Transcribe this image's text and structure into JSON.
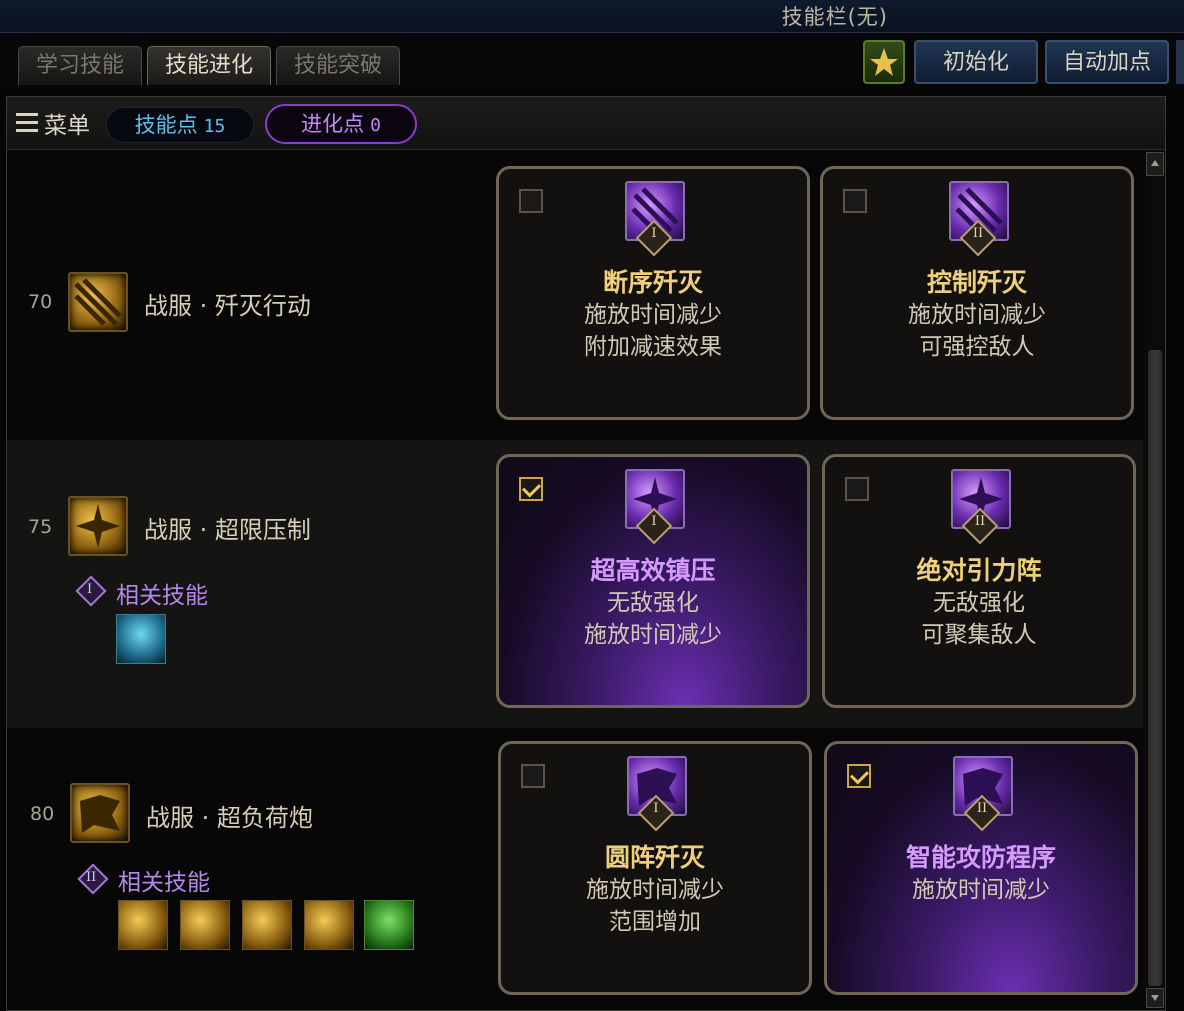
{
  "window": {
    "title": "技能栏(无)"
  },
  "tabs": [
    {
      "label": "学习技能",
      "active": false
    },
    {
      "label": "技能进化",
      "active": true
    },
    {
      "label": "技能突破",
      "active": false
    }
  ],
  "toolbar": {
    "reset_label": "初始化",
    "auto_add_label": "自动加点"
  },
  "menu": {
    "label": "菜单"
  },
  "points": {
    "skill_label": "技能点",
    "skill_value": "15",
    "evo_label": "进化点",
    "evo_value": "0"
  },
  "rows": [
    {
      "level": "70",
      "skill_name": "战服 · 歼灭行动",
      "related_label": "",
      "cards": [
        {
          "rank": "I",
          "checked": false,
          "title": "断序歼灭",
          "lines": [
            "施放时间减少",
            "附加减速效果"
          ]
        },
        {
          "rank": "II",
          "checked": false,
          "title": "控制歼灭",
          "lines": [
            "施放时间减少",
            "可强控敌人"
          ]
        }
      ]
    },
    {
      "level": "75",
      "skill_name": "战服 · 超限压制",
      "related_label": "相关技能",
      "related_rank": "I",
      "cards": [
        {
          "rank": "I",
          "checked": true,
          "title": "超高效镇压",
          "lines": [
            "无敌强化",
            "施放时间减少"
          ]
        },
        {
          "rank": "II",
          "checked": false,
          "title": "绝对引力阵",
          "lines": [
            "无敌强化",
            "可聚集敌人"
          ]
        }
      ]
    },
    {
      "level": "80",
      "skill_name": "战服 · 超负荷炮",
      "related_label": "相关技能",
      "related_rank": "II",
      "cards": [
        {
          "rank": "I",
          "checked": false,
          "title": "圆阵歼灭",
          "lines": [
            "施放时间减少",
            "范围增加"
          ]
        },
        {
          "rank": "II",
          "checked": true,
          "title": "智能攻防程序",
          "lines": [
            "施放时间减少"
          ]
        }
      ]
    }
  ],
  "icons": {
    "menu": "hamburger-icon",
    "auto": "auto-skill-icon",
    "skill": "skill-icon",
    "evolution": "evolution-icon",
    "rank_badge": "rank-diamond-icon"
  },
  "colors": {
    "gold": "#f0cf7a",
    "purple": "#b787f0",
    "blue": "#5ec0f0"
  }
}
